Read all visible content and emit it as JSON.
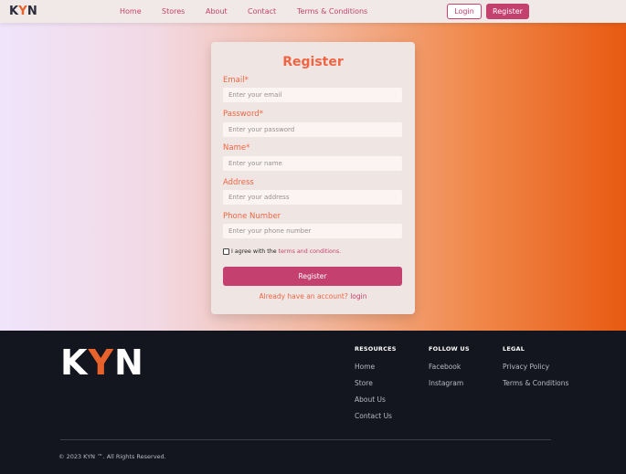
{
  "brand": {
    "k": "K",
    "y": "Y",
    "n": "N"
  },
  "nav": {
    "home": "Home",
    "stores": "Stores",
    "about": "About",
    "contact": "Contact",
    "terms": "Terms & Conditions",
    "login": "Login",
    "register": "Register"
  },
  "form": {
    "title": "Register",
    "email_label": "Email*",
    "email_placeholder": "Enter your email",
    "password_label": "Password*",
    "password_placeholder": "Enter your password",
    "name_label": "Name*",
    "name_placeholder": "Enter your name",
    "address_label": "Address",
    "address_placeholder": "Enter your address",
    "phone_label": "Phone Number",
    "phone_placeholder": "Enter your phone number",
    "agree_text": "I agree with the ",
    "agree_link": "terms and conditions.",
    "submit": "Register",
    "have_account": "Already have an account? ",
    "login_link": "login"
  },
  "footer": {
    "logo_k": "K",
    "logo_y": "Y",
    "logo_n": "N",
    "resources_title": "RESOURCES",
    "resources": [
      "Home",
      "Store",
      "About Us",
      "Contact Us"
    ],
    "follow_title": "FOLLOW US",
    "follow": [
      "Facebook",
      "Instagram"
    ],
    "legal_title": "LEGAL",
    "legal": [
      "Privacy Policy",
      "Terms & Conditions"
    ],
    "copyright": "© 2023 KYN ™. All Rights Reserved."
  },
  "colors": {
    "accent": "#c4406f",
    "label": "#ef6543",
    "brand_y": "#e8622b",
    "footer_bg": "#14161f"
  }
}
